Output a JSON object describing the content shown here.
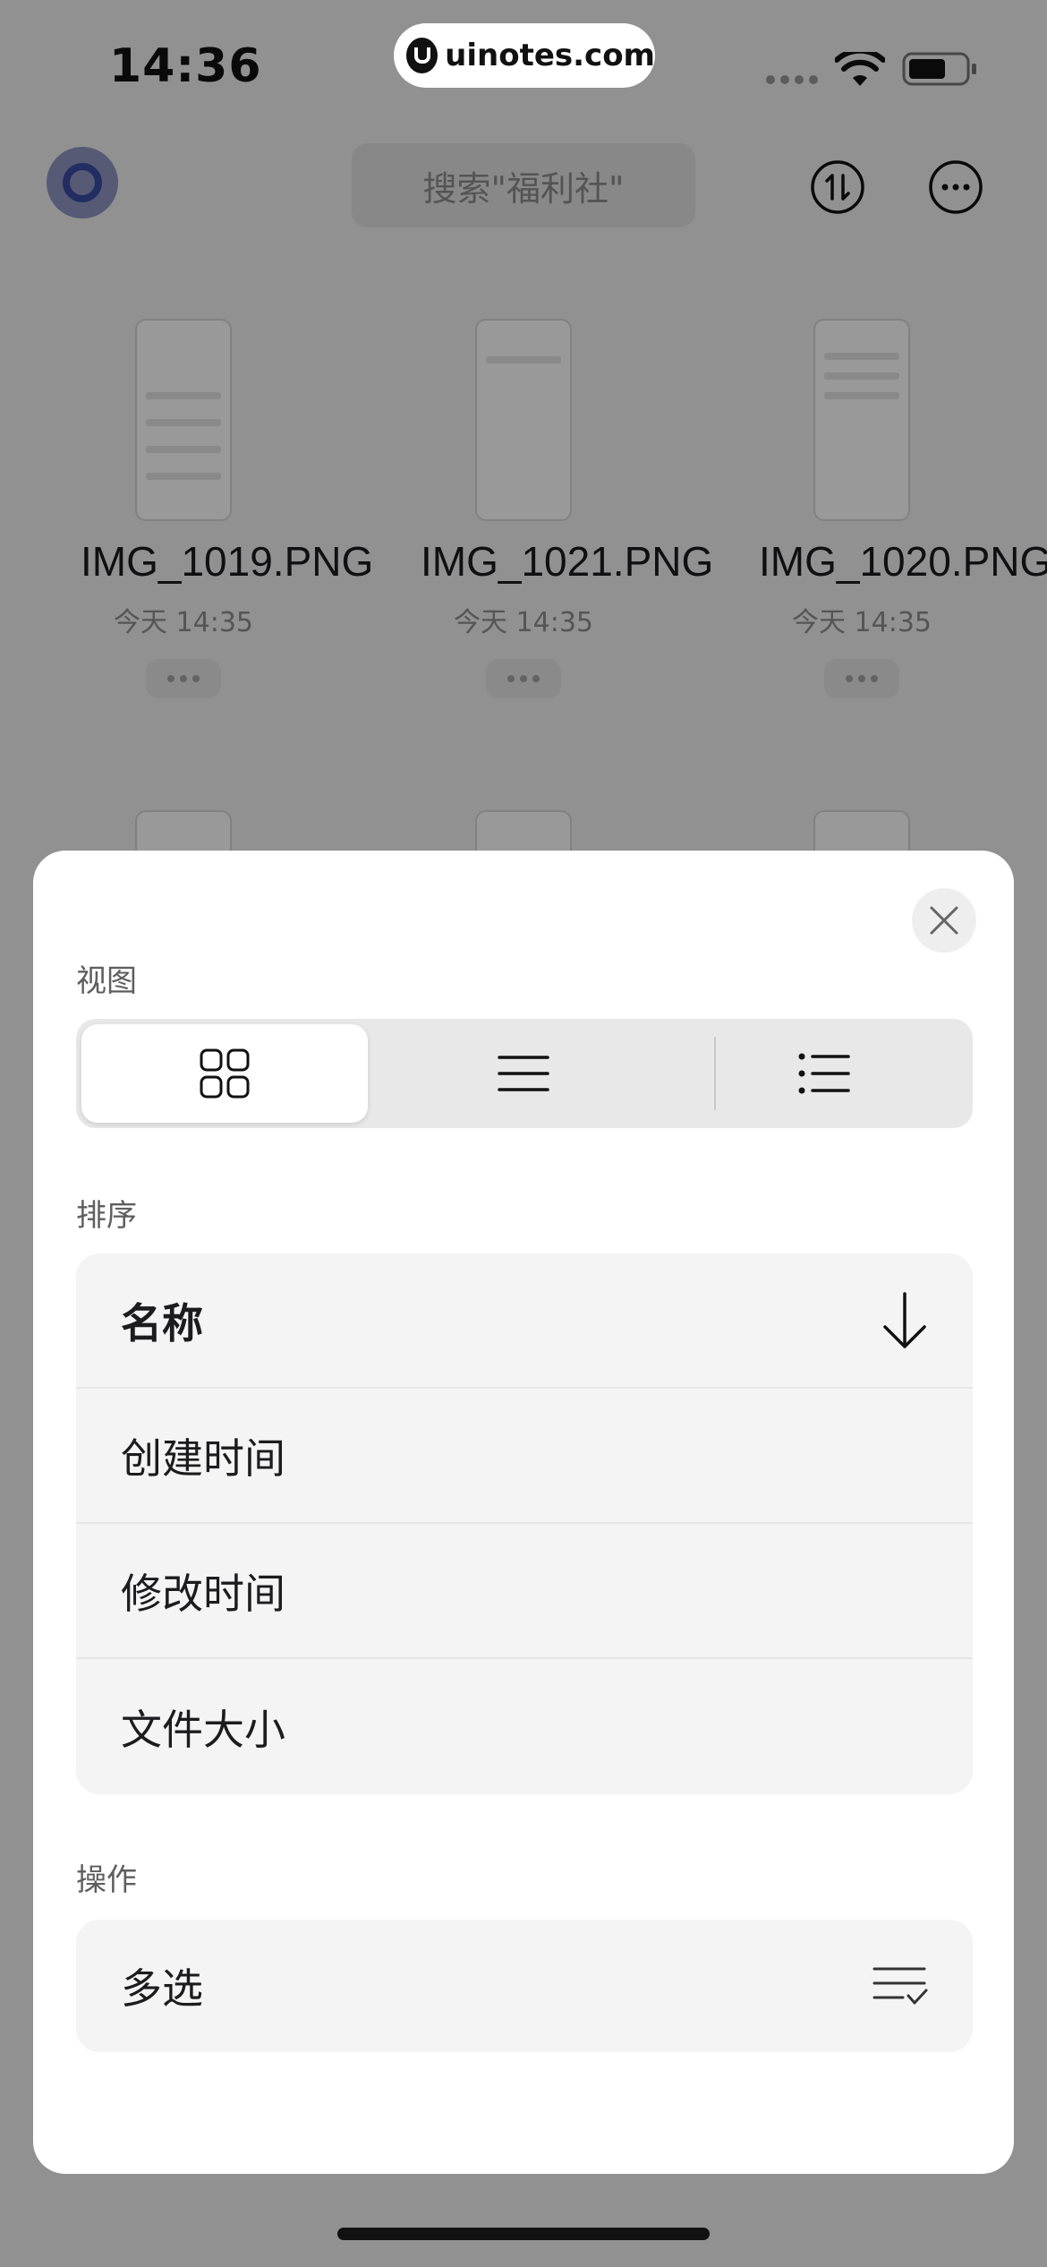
{
  "status_bar": {
    "time": "14:36",
    "watermark": "uinotes.com"
  },
  "header": {
    "search_placeholder": "搜索\"福利社\""
  },
  "files": [
    {
      "name": "IMG_1019.PNG",
      "date": "今天 14:35"
    },
    {
      "name": "IMG_1021.PNG",
      "date": "今天 14:35"
    },
    {
      "name": "IMG_1020.PNG",
      "date": "今天 14:35"
    }
  ],
  "sheet": {
    "view_label": "视图",
    "view_options": [
      "grid-view-icon",
      "list-view-icon",
      "detail-list-icon"
    ],
    "selected_view": "grid-view-icon",
    "sort_label": "排序",
    "sort_options": [
      {
        "label": "名称",
        "active": true,
        "direction": "descending-arrow-icon"
      },
      {
        "label": "创建时间",
        "active": false
      },
      {
        "label": "修改时间",
        "active": false
      },
      {
        "label": "文件大小",
        "active": false
      }
    ],
    "action_label": "操作",
    "actions": [
      {
        "label": "多选",
        "icon": "multi-select-icon"
      }
    ]
  },
  "colors": {
    "accent_blue": "#3b4ca3",
    "sheet_bg": "#ffffff",
    "row_bg": "#f4f4f4",
    "overlay": "#000000"
  }
}
